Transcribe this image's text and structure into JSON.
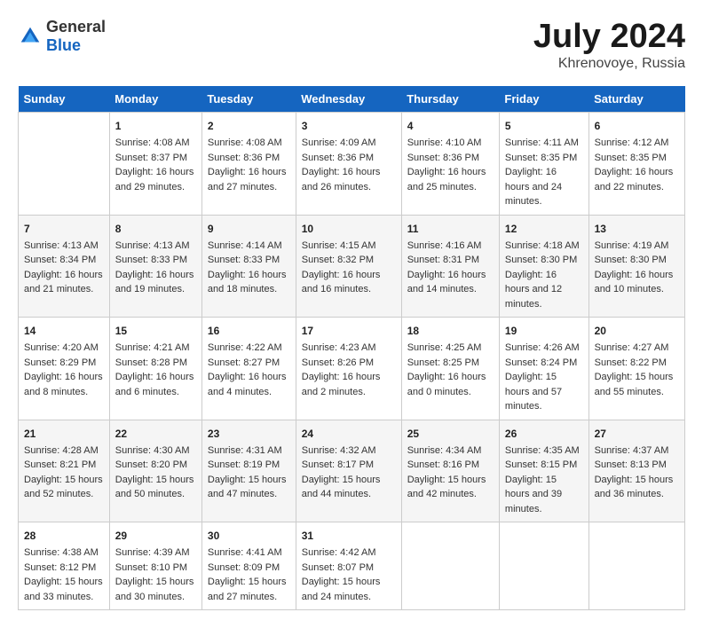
{
  "logo": {
    "general": "General",
    "blue": "Blue"
  },
  "title": "July 2024",
  "subtitle": "Khrenovoye, Russia",
  "days": [
    "Sunday",
    "Monday",
    "Tuesday",
    "Wednesday",
    "Thursday",
    "Friday",
    "Saturday"
  ],
  "weeks": [
    [
      {
        "date": "",
        "sunrise": "",
        "sunset": "",
        "daylight": ""
      },
      {
        "date": "1",
        "sunrise": "Sunrise: 4:08 AM",
        "sunset": "Sunset: 8:37 PM",
        "daylight": "Daylight: 16 hours and 29 minutes."
      },
      {
        "date": "2",
        "sunrise": "Sunrise: 4:08 AM",
        "sunset": "Sunset: 8:36 PM",
        "daylight": "Daylight: 16 hours and 27 minutes."
      },
      {
        "date": "3",
        "sunrise": "Sunrise: 4:09 AM",
        "sunset": "Sunset: 8:36 PM",
        "daylight": "Daylight: 16 hours and 26 minutes."
      },
      {
        "date": "4",
        "sunrise": "Sunrise: 4:10 AM",
        "sunset": "Sunset: 8:36 PM",
        "daylight": "Daylight: 16 hours and 25 minutes."
      },
      {
        "date": "5",
        "sunrise": "Sunrise: 4:11 AM",
        "sunset": "Sunset: 8:35 PM",
        "daylight": "Daylight: 16 hours and 24 minutes."
      },
      {
        "date": "6",
        "sunrise": "Sunrise: 4:12 AM",
        "sunset": "Sunset: 8:35 PM",
        "daylight": "Daylight: 16 hours and 22 minutes."
      }
    ],
    [
      {
        "date": "7",
        "sunrise": "Sunrise: 4:13 AM",
        "sunset": "Sunset: 8:34 PM",
        "daylight": "Daylight: 16 hours and 21 minutes."
      },
      {
        "date": "8",
        "sunrise": "Sunrise: 4:13 AM",
        "sunset": "Sunset: 8:33 PM",
        "daylight": "Daylight: 16 hours and 19 minutes."
      },
      {
        "date": "9",
        "sunrise": "Sunrise: 4:14 AM",
        "sunset": "Sunset: 8:33 PM",
        "daylight": "Daylight: 16 hours and 18 minutes."
      },
      {
        "date": "10",
        "sunrise": "Sunrise: 4:15 AM",
        "sunset": "Sunset: 8:32 PM",
        "daylight": "Daylight: 16 hours and 16 minutes."
      },
      {
        "date": "11",
        "sunrise": "Sunrise: 4:16 AM",
        "sunset": "Sunset: 8:31 PM",
        "daylight": "Daylight: 16 hours and 14 minutes."
      },
      {
        "date": "12",
        "sunrise": "Sunrise: 4:18 AM",
        "sunset": "Sunset: 8:30 PM",
        "daylight": "Daylight: 16 hours and 12 minutes."
      },
      {
        "date": "13",
        "sunrise": "Sunrise: 4:19 AM",
        "sunset": "Sunset: 8:30 PM",
        "daylight": "Daylight: 16 hours and 10 minutes."
      }
    ],
    [
      {
        "date": "14",
        "sunrise": "Sunrise: 4:20 AM",
        "sunset": "Sunset: 8:29 PM",
        "daylight": "Daylight: 16 hours and 8 minutes."
      },
      {
        "date": "15",
        "sunrise": "Sunrise: 4:21 AM",
        "sunset": "Sunset: 8:28 PM",
        "daylight": "Daylight: 16 hours and 6 minutes."
      },
      {
        "date": "16",
        "sunrise": "Sunrise: 4:22 AM",
        "sunset": "Sunset: 8:27 PM",
        "daylight": "Daylight: 16 hours and 4 minutes."
      },
      {
        "date": "17",
        "sunrise": "Sunrise: 4:23 AM",
        "sunset": "Sunset: 8:26 PM",
        "daylight": "Daylight: 16 hours and 2 minutes."
      },
      {
        "date": "18",
        "sunrise": "Sunrise: 4:25 AM",
        "sunset": "Sunset: 8:25 PM",
        "daylight": "Daylight: 16 hours and 0 minutes."
      },
      {
        "date": "19",
        "sunrise": "Sunrise: 4:26 AM",
        "sunset": "Sunset: 8:24 PM",
        "daylight": "Daylight: 15 hours and 57 minutes."
      },
      {
        "date": "20",
        "sunrise": "Sunrise: 4:27 AM",
        "sunset": "Sunset: 8:22 PM",
        "daylight": "Daylight: 15 hours and 55 minutes."
      }
    ],
    [
      {
        "date": "21",
        "sunrise": "Sunrise: 4:28 AM",
        "sunset": "Sunset: 8:21 PM",
        "daylight": "Daylight: 15 hours and 52 minutes."
      },
      {
        "date": "22",
        "sunrise": "Sunrise: 4:30 AM",
        "sunset": "Sunset: 8:20 PM",
        "daylight": "Daylight: 15 hours and 50 minutes."
      },
      {
        "date": "23",
        "sunrise": "Sunrise: 4:31 AM",
        "sunset": "Sunset: 8:19 PM",
        "daylight": "Daylight: 15 hours and 47 minutes."
      },
      {
        "date": "24",
        "sunrise": "Sunrise: 4:32 AM",
        "sunset": "Sunset: 8:17 PM",
        "daylight": "Daylight: 15 hours and 44 minutes."
      },
      {
        "date": "25",
        "sunrise": "Sunrise: 4:34 AM",
        "sunset": "Sunset: 8:16 PM",
        "daylight": "Daylight: 15 hours and 42 minutes."
      },
      {
        "date": "26",
        "sunrise": "Sunrise: 4:35 AM",
        "sunset": "Sunset: 8:15 PM",
        "daylight": "Daylight: 15 hours and 39 minutes."
      },
      {
        "date": "27",
        "sunrise": "Sunrise: 4:37 AM",
        "sunset": "Sunset: 8:13 PM",
        "daylight": "Daylight: 15 hours and 36 minutes."
      }
    ],
    [
      {
        "date": "28",
        "sunrise": "Sunrise: 4:38 AM",
        "sunset": "Sunset: 8:12 PM",
        "daylight": "Daylight: 15 hours and 33 minutes."
      },
      {
        "date": "29",
        "sunrise": "Sunrise: 4:39 AM",
        "sunset": "Sunset: 8:10 PM",
        "daylight": "Daylight: 15 hours and 30 minutes."
      },
      {
        "date": "30",
        "sunrise": "Sunrise: 4:41 AM",
        "sunset": "Sunset: 8:09 PM",
        "daylight": "Daylight: 15 hours and 27 minutes."
      },
      {
        "date": "31",
        "sunrise": "Sunrise: 4:42 AM",
        "sunset": "Sunset: 8:07 PM",
        "daylight": "Daylight: 15 hours and 24 minutes."
      },
      {
        "date": "",
        "sunrise": "",
        "sunset": "",
        "daylight": ""
      },
      {
        "date": "",
        "sunrise": "",
        "sunset": "",
        "daylight": ""
      },
      {
        "date": "",
        "sunrise": "",
        "sunset": "",
        "daylight": ""
      }
    ]
  ]
}
